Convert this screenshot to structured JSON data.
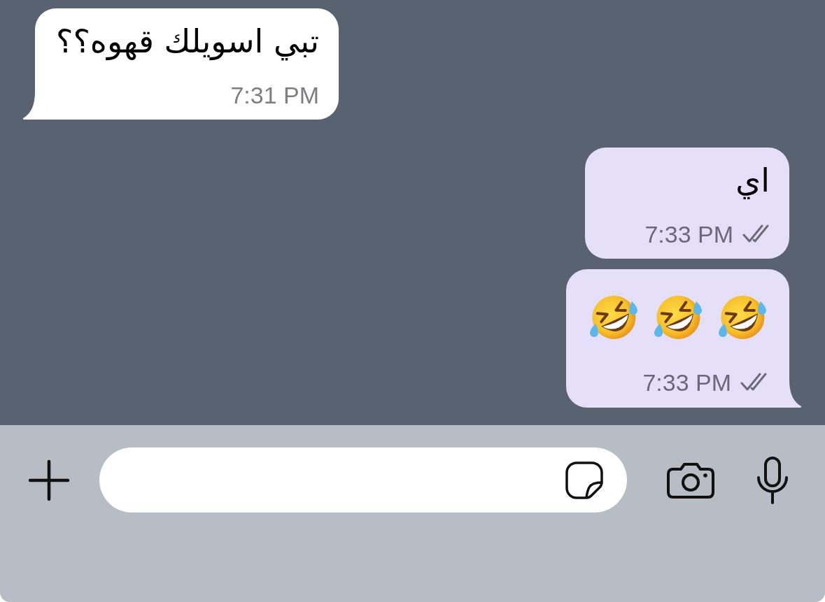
{
  "messages": [
    {
      "outgoing": false,
      "kind": "text",
      "text": "تبي اسويلك قهوه؟؟",
      "time": "7:31 PM",
      "tail": true
    },
    {
      "outgoing": true,
      "kind": "text",
      "text": "اي",
      "time": "7:33 PM",
      "delivered": true,
      "tail": false
    },
    {
      "outgoing": true,
      "kind": "emoji",
      "emojis": [
        {
          "kind": "rofl"
        },
        {
          "kind": "rofl"
        },
        {
          "kind": "rofl"
        }
      ],
      "time": "7:33 PM",
      "delivered": true,
      "tail": true
    }
  ]
}
